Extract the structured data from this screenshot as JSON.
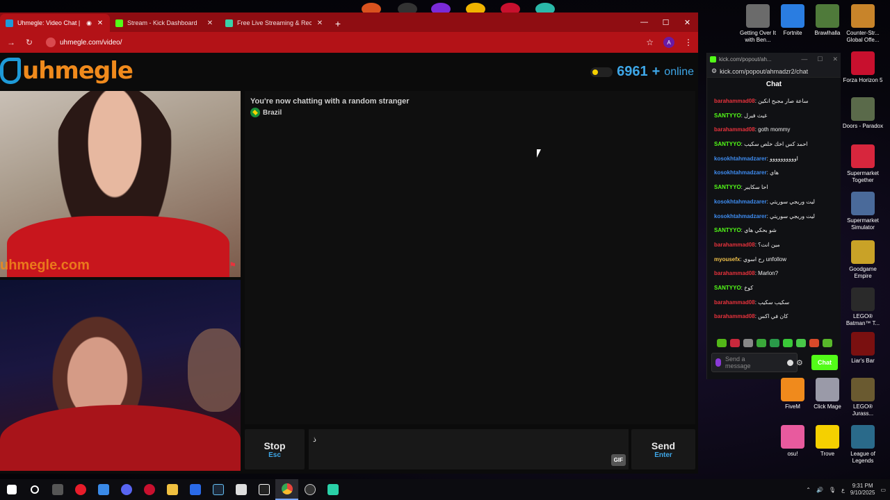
{
  "browser": {
    "tabs": [
      {
        "title": "Uhmegle: Video Chat | Om",
        "active": true,
        "favicon_color": "#1e9ad8"
      },
      {
        "title": "Stream - Kick Dashboard",
        "active": false,
        "favicon_color": "#53fc18"
      },
      {
        "title": "Free Live Streaming & Recordin",
        "active": false,
        "favicon_color": "#3ad1a8"
      }
    ],
    "new_tab": "+",
    "url": "uhmegle.com/video/",
    "profile_initial": "A"
  },
  "site": {
    "logo_text": "uhmegle",
    "online_count": "6961",
    "online_plus": "+",
    "online_label": "online",
    "watermark": "uhmegle.com"
  },
  "chat": {
    "status": "You're now chatting with a random stranger",
    "country": "Brazil",
    "input_value": "ذ",
    "gif_label": "GIF",
    "stop_label": "Stop",
    "stop_hint": "Esc",
    "send_label": "Send",
    "send_hint": "Enter"
  },
  "kick": {
    "window_title": "kick.com/popout/ah...",
    "url": "kick.com/popout/ahmadzr2/chat",
    "header": "Chat",
    "messages": [
      {
        "user": "barahammad08",
        "color": "#e8323c",
        "text": "ساعة صار مجبح انكين"
      },
      {
        "user": "SANTYYO",
        "color": "#53fc18",
        "text": "غيث فيرل"
      },
      {
        "user": "barahammad08",
        "color": "#e8323c",
        "text": "goth mommy"
      },
      {
        "user": "SANTYYO",
        "color": "#53fc18",
        "text": "احمد كس اخك خلص سكيب"
      },
      {
        "user": "kosokhtahmadzarer",
        "color": "#3e8cf0",
        "text": "اوووووووووو"
      },
      {
        "user": "kosokhtahmadzarer",
        "color": "#3e8cf0",
        "text": "هاي"
      },
      {
        "user": "SANTYYO",
        "color": "#53fc18",
        "text": "احا سكايبر"
      },
      {
        "user": "kosokhtahmadzarer",
        "color": "#3e8cf0",
        "text": "ليت وريجي سوريتي"
      },
      {
        "user": "kosokhtahmadzarer",
        "color": "#3e8cf0",
        "text": "ليت وريجي سوريتي"
      },
      {
        "user": "SANTYYO",
        "color": "#53fc18",
        "text": "شو بحكي هاي"
      },
      {
        "user": "barahammad08",
        "color": "#e8323c",
        "text": "مين انت؟"
      },
      {
        "user": "myousefx",
        "color": "#f0c14b",
        "text": "رح اسوي unfollow"
      },
      {
        "user": "barahammad08",
        "color": "#e8323c",
        "text": "Marlon?"
      },
      {
        "user": "SANTYYO",
        "color": "#53fc18",
        "text": "كوخ"
      },
      {
        "user": "barahammad08",
        "color": "#e8323c",
        "text": "سكيب سكيب"
      },
      {
        "user": "barahammad08",
        "color": "#e8323c",
        "text": "كان في اكس"
      }
    ],
    "input_placeholder": "Send a message",
    "chat_button": "Chat"
  },
  "desktop_icons": [
    {
      "label": "Getting Over It with Ben...",
      "color": "#6b6b6b"
    },
    {
      "label": "Fortnite",
      "color": "#2a7de1"
    },
    {
      "label": "Brawlhalla",
      "color": "#4f7a3a"
    },
    {
      "label": "Counter-Str... Global Offe...",
      "color": "#c8842a"
    },
    {
      "label": "Forza Horizon 5",
      "color": "#c8102e"
    },
    {
      "label": "Doors - Paradox",
      "color": "#5a6a4a"
    },
    {
      "label": "Supermarket Together",
      "color": "#d7263d"
    },
    {
      "label": "Supermarket Simulator",
      "color": "#4a6a9a"
    },
    {
      "label": "Goodgame Empire",
      "color": "#c9a227"
    },
    {
      "label": "LEGO® Batman™ T...",
      "color": "#2a2a2a"
    },
    {
      "label": "Liar's Bar",
      "color": "#7a1010"
    },
    {
      "label": "FiveM",
      "color": "#f08a1c"
    },
    {
      "label": "Click Mage",
      "color": "#9a9aa8"
    },
    {
      "label": "LEGO® Jurass...",
      "color": "#6a5a30"
    },
    {
      "label": "osu!",
      "color": "#e85a9e"
    },
    {
      "label": "Trove",
      "color": "#f5d000"
    },
    {
      "label": "League of Legends",
      "color": "#2a6a8a"
    }
  ],
  "taskbar": {
    "time": "9:31 PM",
    "date": "9/10/2025",
    "lang": "ع"
  }
}
